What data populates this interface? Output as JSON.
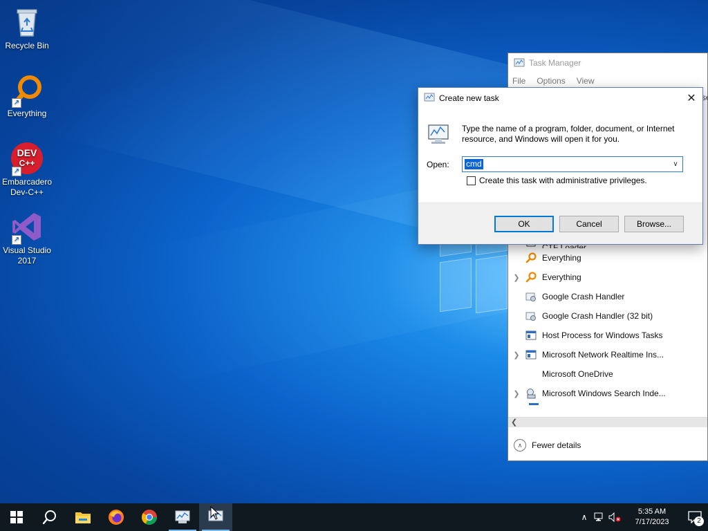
{
  "desktop": {
    "icons": [
      {
        "label": "Recycle Bin"
      },
      {
        "label": "Everything"
      },
      {
        "label": "Embarcadero Dev-C++"
      },
      {
        "label": "Visual Studio 2017"
      }
    ],
    "devcpp_logo": "DEV C++"
  },
  "task_manager": {
    "title": "Task Manager",
    "menu": [
      "File",
      "Options",
      "View"
    ],
    "title_overflow": "se",
    "partial_row_label": "CTF Loader",
    "processes": [
      {
        "label": "Everything",
        "expandable": false,
        "icon": "magnifier-icon"
      },
      {
        "label": "Everything",
        "expandable": true,
        "icon": "magnifier-icon"
      },
      {
        "label": "Google Crash Handler",
        "expandable": false,
        "icon": "gear-app-icon"
      },
      {
        "label": "Google Crash Handler (32 bit)",
        "expandable": false,
        "icon": "gear-app-icon"
      },
      {
        "label": "Host Process for Windows Tasks",
        "expandable": false,
        "icon": "window-icon"
      },
      {
        "label": "Microsoft Network Realtime Ins...",
        "expandable": true,
        "icon": "window-icon"
      },
      {
        "label": "Microsoft OneDrive",
        "expandable": false,
        "icon": "none"
      },
      {
        "label": "Microsoft Windows Search Inde...",
        "expandable": true,
        "icon": "search-indexer-icon"
      }
    ],
    "fewer_details": "Fewer details"
  },
  "dialog": {
    "title": "Create new task",
    "description": "Type the name of a program, folder, document, or Internet resource, and Windows will open it for you.",
    "open_label": "Open:",
    "open_value": "cmd",
    "admin_checkbox_label": "Create this task with administrative privileges.",
    "admin_checked": false,
    "ok_label": "OK",
    "cancel_label": "Cancel",
    "browse_label": "Browse..."
  },
  "taskbar": {
    "apps": [
      "start",
      "search",
      "file-explorer",
      "firefox",
      "chrome",
      "task-manager",
      "run-dialog"
    ],
    "clock_time": "5:35 AM",
    "clock_date": "7/17/2023",
    "notification_count": "2",
    "accent": "#76b9ed"
  }
}
